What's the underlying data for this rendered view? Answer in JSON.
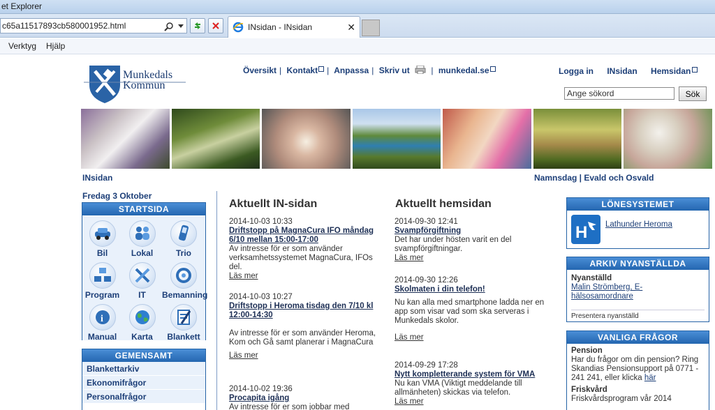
{
  "browser": {
    "title": "et Explorer",
    "address": "c65a11517893cb580001952.html",
    "tab_label": "INsidan - INsidan",
    "tab_close": "✕",
    "menu": [
      "Verktyg",
      "Hjälp"
    ]
  },
  "header": {
    "logo_line1": "Munkedals",
    "logo_line2": "Kommun",
    "nav": [
      "Översikt",
      "Kontakt",
      "Anpassa",
      "Skriv ut",
      "munkedal.se"
    ],
    "links": [
      "Logga in",
      "INsidan",
      "Hemsidan"
    ],
    "search_placeholder": "Ange sökord",
    "search_button": "Sök"
  },
  "subheader": {
    "insidan": "INsidan",
    "namnsdag": "Namnsdag | Evald och Osvald",
    "date": "Fredag 3 Oktober"
  },
  "startsida": {
    "title": "STARTSIDA",
    "items": [
      {
        "label": "Bil",
        "icon": "car-icon"
      },
      {
        "label": "Lokal",
        "icon": "people-icon"
      },
      {
        "label": "Trio",
        "icon": "phone-icon"
      },
      {
        "label": "Program",
        "icon": "program-icon"
      },
      {
        "label": "IT",
        "icon": "tools-icon"
      },
      {
        "label": "Bemanning",
        "icon": "staffing-icon"
      },
      {
        "label": "Manual",
        "icon": "manual-icon"
      },
      {
        "label": "Karta",
        "icon": "globe-icon"
      },
      {
        "label": "Blankett",
        "icon": "form-icon"
      }
    ]
  },
  "gemensamt": {
    "title": "GEMENSAMT",
    "items": [
      "Blankettarkiv",
      "Ekonomifrågor",
      "Personalfrågor"
    ]
  },
  "in_sidan": {
    "title": "Aktuellt IN-sidan",
    "news": [
      {
        "time": "2014-10-03 10:33",
        "title": "Driftstopp på MagnaCura IFO måndag 6/10 mellan 15:00-17:00",
        "body": "Av intresse för er som använder verksamhetssystemet MagnaCura, IFOs del.",
        "more": "Läs mer"
      },
      {
        "time": "2014-10-03 10:27",
        "title": "Driftstopp i Heroma tisdag den 7/10 kl 12:00-14:30",
        "body": "Av intresse för er som använder Heroma, Kom och Gå samt planerar i MagnaCura",
        "more": "Läs mer"
      },
      {
        "time": "2014-10-02 19:36",
        "title": "Procapita igång",
        "body": "Av intresse för er som jobbar med",
        "more": ""
      }
    ]
  },
  "hemsidan": {
    "title": "Aktuellt hemsidan",
    "news": [
      {
        "time": "2014-09-30 12:41",
        "title": "Svampförgiftning",
        "body": "Det har under hösten varit en del svampförgiftningar.",
        "more": "Läs mer"
      },
      {
        "time": "2014-09-30 12:26",
        "title": "Skolmaten i din telefon!",
        "body": "Nu kan alla med smartphone ladda ner en app som visar vad som ska serveras i Munkedals skolor.",
        "more": "Läs mer"
      },
      {
        "time": "2014-09-29 17:28",
        "title": "Nytt kompletterande system för VMA",
        "body": "Nu kan VMA (Viktigt meddelande till allmänheten) skickas via telefon.",
        "more": "Läs mer"
      }
    ]
  },
  "lonesystemet": {
    "title": "LÖNESYSTEMET",
    "link": "Lathunder Heroma"
  },
  "arkiv": {
    "title": "ARKIV NYANSTÄLLDA",
    "heading": "Nyanställd",
    "link": "Malin Strömberg, E-hälsosamordnare",
    "footer": "Presentera nyanställd"
  },
  "faq": {
    "title": "VANLIGA FRÅGOR",
    "pension_heading": "Pension",
    "pension_body": "Har du frågor om din pension? Ring Skandias Pensionsupport på 0771 - 241 241, eller klicka",
    "pension_link": "här",
    "frisk_heading": "Friskvård",
    "frisk_body": "Friskvårdsprogram vår 2014"
  },
  "colors": {
    "accent": "#2466b0",
    "link": "#1d3f78"
  }
}
